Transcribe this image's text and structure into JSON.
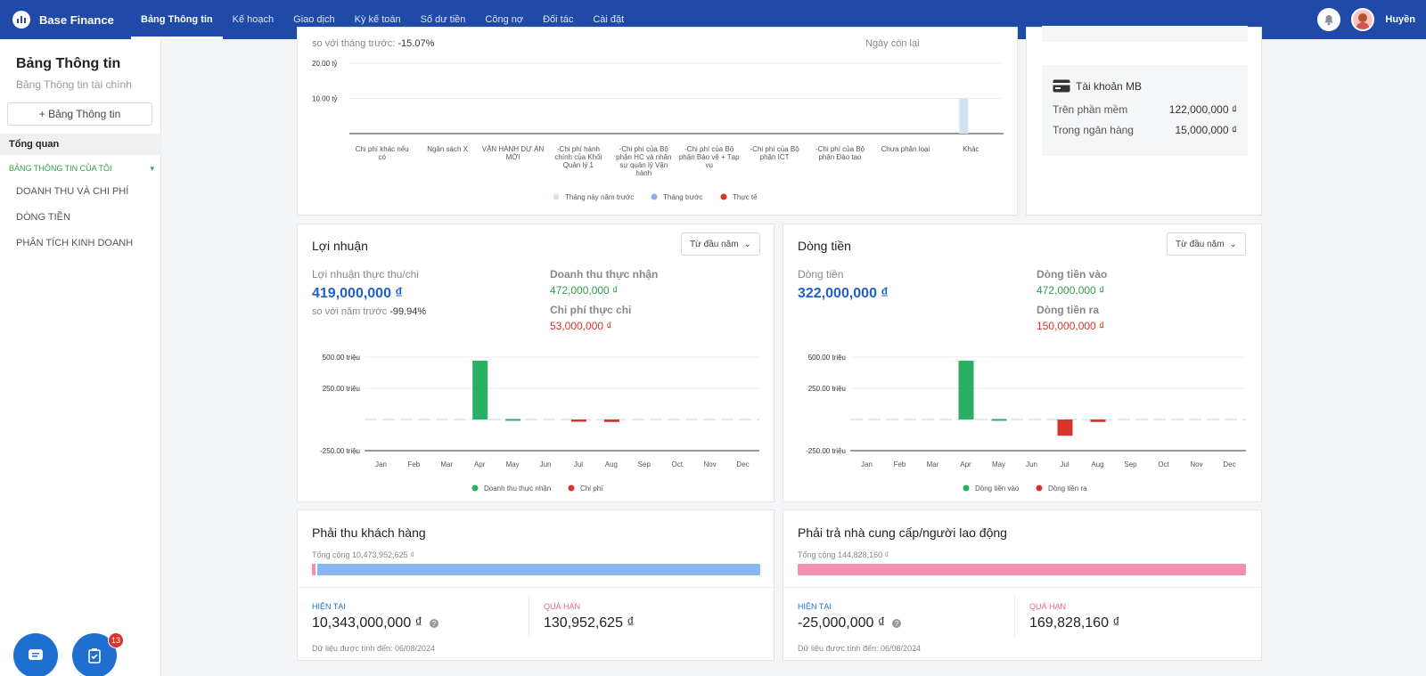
{
  "topbar": {
    "brand": "Base Finance",
    "nav": [
      "Bảng Thông tin",
      "Kế hoạch",
      "Giao dịch",
      "Kỳ kế toán",
      "Số dư tiền",
      "Công nợ",
      "Đối tác",
      "Cài đặt"
    ],
    "active_index": 0,
    "icons": [
      "logo-icon",
      "bell-icon",
      "avatar"
    ],
    "user": "Huyền"
  },
  "sidebar": {
    "title": "Bảng Thông tin",
    "subtitle": "Bảng Thông tin tài chính",
    "add_button": "+ Bảng Thông tin",
    "overview": "Tổng quan",
    "group": "BẢNG THÔNG TIN CỦA TÔI",
    "links": [
      "DOANH THU VÀ CHI PHÍ",
      "DÒNG TIỀN",
      "PHÂN TÍCH KINH DOANH"
    ],
    "badge": "13"
  },
  "expense_card": {
    "compare_label": "so với tháng trước:",
    "compare_value": "-15.07%",
    "right_label": "Ngày còn lại",
    "y_ticks": [
      "20.00 tỷ",
      "10.00 tỷ"
    ],
    "categories": [
      "Chi phí khác nếu có",
      "Ngân sách X",
      "VẬN HÀNH DỰ ÁN MỚI",
      "-Chi phí hành chính của Khối Quản lý 1",
      "-Chi phí của Bộ phận HC và nhân sự quản lý Vận hành",
      "-Chi phí của Bộ phận Bảo vệ + Tạp vụ",
      "-Chi phí của Bộ phận ICT",
      "-Chi phí của Bộ phận Đào tạo",
      "Chưa phân loại",
      "Khác"
    ],
    "legend": [
      "Tháng này năm trước",
      "Tháng trước",
      "Thực tế"
    ],
    "colors": [
      "#d4e1f3",
      "#8eb4e3",
      "#d9342b"
    ]
  },
  "bank_card": {
    "icon": "credit-card-icon",
    "account": "Tài khoản MB",
    "rows": [
      {
        "label": "Trên phần mềm",
        "value": "122,000,000 ₫"
      },
      {
        "label": "Trong ngân hàng",
        "value": "15,000,000 ₫"
      }
    ]
  },
  "profit_card": {
    "title": "Lợi nhuận",
    "dropdown": "Từ đầu năm",
    "main_label": "Lợi nhuận thực thu/chi",
    "main_value": "419,000,000 ₫",
    "compare_label": "so với năm trước",
    "compare_value": "-99.94%",
    "kpi1_label": "Doanh thu thực nhận",
    "kpi1_value": "472,000,000 ₫",
    "kpi2_label": "Chi phí thực chi",
    "kpi2_value": "53,000,000 ₫",
    "y_ticks": [
      "500.00 triệu",
      "250.00 triệu",
      "-250.00 triệu"
    ],
    "legend": [
      "Doanh thu thực nhận",
      "Chi phí"
    ]
  },
  "cash_card": {
    "title": "Dòng tiền",
    "dropdown": "Từ đầu năm",
    "main_label": "Dòng tiền",
    "main_value": "322,000,000 ₫",
    "kpi1_label": "Dòng tiền vào",
    "kpi1_value": "472,000,000 ₫",
    "kpi2_label": "Dòng tiền ra",
    "kpi2_value": "150,000,000 ₫",
    "y_ticks": [
      "500.00 triệu",
      "250.00 triệu",
      "-250.00 triệu"
    ],
    "legend": [
      "Dòng tiền vào",
      "Dòng tiền ra"
    ]
  },
  "receivable_card": {
    "title": "Phải thu khách hàng",
    "total": "Tổng cộng 10,473,952,625 ₫",
    "current_label": "HIỆN TẠI",
    "current_value": "10,343,000,000 ₫",
    "overdue_label": "QUÁ HẠN",
    "overdue_value": "130,952,625 ₫",
    "footer": "Dữ liệu được tính đến: 06/08/2024",
    "overdue_fraction": 0.0125
  },
  "payable_card": {
    "title": "Phải trả nhà cung cấp/người lao động",
    "total": "Tổng cộng 144,828,160 ₫",
    "current_label": "HIỆN TẠI",
    "current_value": "-25,000,000 ₫",
    "overdue_label": "QUÁ HẠN",
    "overdue_value": "169,828,160 ₫",
    "footer": "Dữ liệu được tính đến: 06/08/2024"
  },
  "chart_data": [
    {
      "type": "bar",
      "title": "",
      "categories": [
        "Chi phí khác nếu có",
        "Ngân sách X",
        "VẬN HÀNH DỰ ÁN MỚI",
        "-Chi phí hành chính của Khối Quản lý 1",
        "-Chi phí của Bộ phận HC và nhân sự quản lý Vận hành",
        "-Chi phí của Bộ phận Bảo vệ + Tạp vụ",
        "-Chi phí của Bộ phận ICT",
        "-Chi phí của Bộ phận Đào tạo",
        "Chưa phân loại",
        "Khác"
      ],
      "series": [
        {
          "name": "Tháng này năm trước",
          "values": [
            0,
            0,
            0,
            0,
            0,
            0,
            0,
            0,
            0,
            10
          ]
        },
        {
          "name": "Tháng trước",
          "values": [
            0,
            0,
            0,
            0,
            0,
            0,
            0,
            0,
            0,
            0
          ]
        },
        {
          "name": "Thực tế",
          "values": [
            0,
            0,
            0,
            0,
            0,
            0,
            0,
            0,
            0,
            0
          ]
        }
      ],
      "ylabel": "tỷ",
      "ylim": [
        0,
        20
      ],
      "legend": "bottom"
    },
    {
      "type": "bar",
      "title": "Lợi nhuận",
      "categories": [
        "Jan",
        "Feb",
        "Mar",
        "Apr",
        "May",
        "Jun",
        "Jul",
        "Aug",
        "Sep",
        "Oct",
        "Nov",
        "Dec"
      ],
      "series": [
        {
          "name": "Doanh thu thực nhận",
          "values": [
            0,
            0,
            0,
            472,
            4,
            0,
            0,
            0,
            0,
            0,
            0,
            0
          ]
        },
        {
          "name": "Chi phí",
          "values": [
            0,
            0,
            0,
            0,
            0,
            0,
            -18,
            -20,
            0,
            0,
            0,
            0
          ]
        }
      ],
      "ylabel": "triệu",
      "ylim": [
        -250,
        500
      ],
      "legend": "bottom"
    },
    {
      "type": "bar",
      "title": "Dòng tiền",
      "categories": [
        "Jan",
        "Feb",
        "Mar",
        "Apr",
        "May",
        "Jun",
        "Jul",
        "Aug",
        "Sep",
        "Oct",
        "Nov",
        "Dec"
      ],
      "series": [
        {
          "name": "Dòng tiền vào",
          "values": [
            0,
            0,
            0,
            472,
            4,
            0,
            0,
            0,
            0,
            0,
            0,
            0
          ]
        },
        {
          "name": "Dòng tiền ra",
          "values": [
            0,
            0,
            0,
            0,
            0,
            0,
            -130,
            -20,
            0,
            0,
            0,
            0
          ]
        }
      ],
      "ylabel": "triệu",
      "ylim": [
        -250,
        500
      ],
      "legend": "bottom"
    }
  ]
}
